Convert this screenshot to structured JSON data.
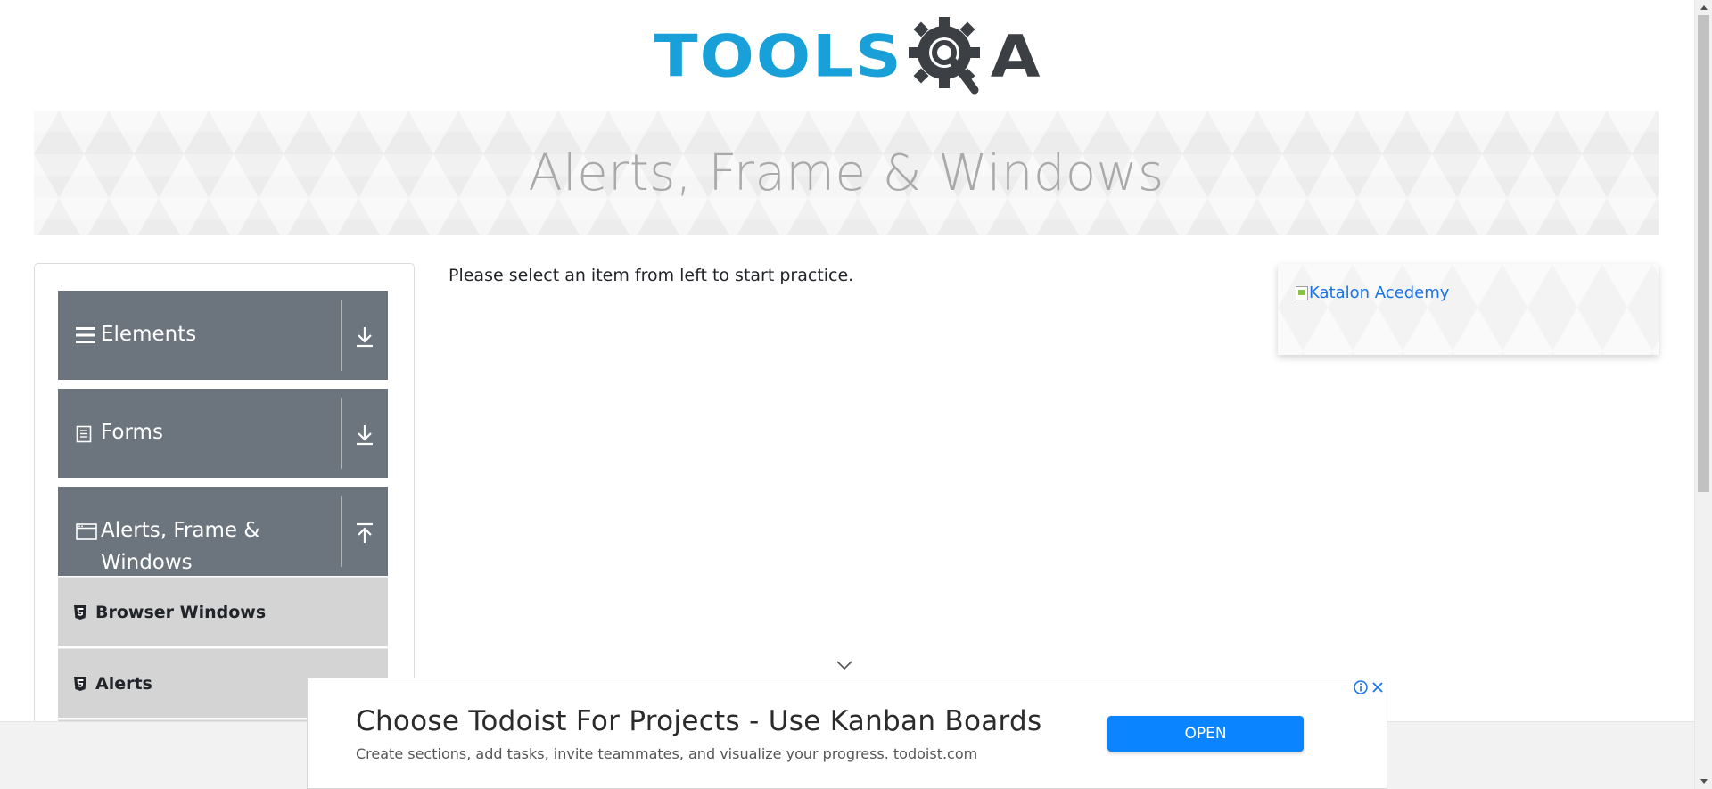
{
  "header": {
    "logo_text_left": "TOOLS",
    "logo_text_right": "A"
  },
  "banner": {
    "title": "Alerts, Frame & Windows"
  },
  "sidebar": {
    "groups": [
      {
        "label": "Elements",
        "icon": "list-icon",
        "arrow": "download-arrow-icon"
      },
      {
        "label": "Forms",
        "icon": "document-icon",
        "arrow": "download-arrow-icon"
      },
      {
        "label": "Alerts, Frame &",
        "label_line2": "Windows",
        "icon": "window-icon",
        "arrow": "upload-arrow-icon"
      }
    ],
    "sub_items": [
      {
        "label": "Browser Windows",
        "icon": "html5-icon"
      },
      {
        "label": "Alerts",
        "icon": "html5-icon"
      }
    ]
  },
  "main": {
    "message": "Please select an item from left to start practice."
  },
  "side_ad": {
    "link_text": "Katalon Acedemy"
  },
  "bottom_ad": {
    "title": "Choose Todoist For Projects - Use Kanban Boards",
    "description": "Create sections, add tasks, invite teammates, and visualize your progress. todoist.com",
    "button_label": "OPEN",
    "info_icon": "info-icon",
    "close_icon": "close-icon"
  },
  "colors": {
    "brand_blue": "#1aa0d8",
    "brand_dark": "#3c3f44",
    "sidebar_group": "#6c757d",
    "sidebar_sub": "#d4d4d4",
    "ad_button": "#0a84ff",
    "link": "#1a73e8"
  }
}
